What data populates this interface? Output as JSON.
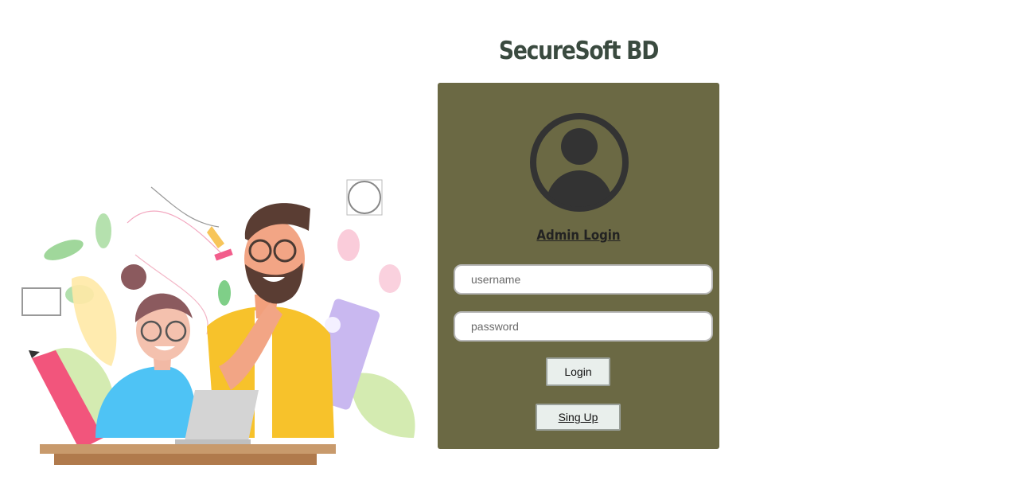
{
  "brand": {
    "title": "SecureSoft BD"
  },
  "login_card": {
    "avatar_icon": "user-circle-icon",
    "heading": "Admin Login",
    "username": {
      "placeholder": "username",
      "value": ""
    },
    "password": {
      "placeholder": "password",
      "value": ""
    },
    "login_label": "Login",
    "signup_label": "Sing Up"
  },
  "illustration": {
    "description": "two-people-working-illustration"
  },
  "colors": {
    "card_background": "#6b6944",
    "title_text": "#3a4a3f",
    "button_background": "#e9efec",
    "avatar": "#333333"
  }
}
